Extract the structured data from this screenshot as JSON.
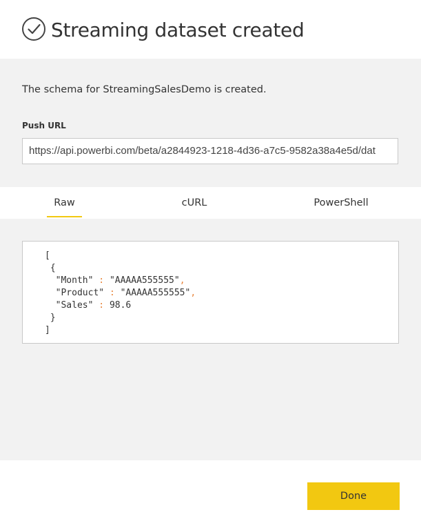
{
  "dialog": {
    "title": "Streaming dataset created",
    "message": "The schema for StreamingSalesDemo is created.",
    "push_url_label": "Push URL",
    "push_url_value": "https://api.powerbi.com/beta/a2844923-1218-4d36-a7c5-9582a38a4e5d/dat",
    "tabs": [
      {
        "label": "Raw",
        "active": true
      },
      {
        "label": "cURL",
        "active": false
      },
      {
        "label": "PowerShell",
        "active": false
      }
    ],
    "code": {
      "open_bracket": "[",
      "open_brace": "{",
      "fields": [
        {
          "key": "\"Month\"",
          "sep": ":",
          "value": "\"AAAAA555555\"",
          "comma": ","
        },
        {
          "key": "\"Product\"",
          "sep": ":",
          "value": "\"AAAAA555555\"",
          "comma": ","
        },
        {
          "key": "\"Sales\"",
          "sep": ":",
          "value": "98.6",
          "comma": ""
        }
      ],
      "close_brace": "}",
      "close_bracket": "]"
    },
    "done_label": "Done"
  },
  "colors": {
    "accent": "#f2c811",
    "panel_bg": "#f2f2f2",
    "code_punctuation": "#e8843a"
  },
  "icons": {
    "header": "check-circle-icon"
  }
}
